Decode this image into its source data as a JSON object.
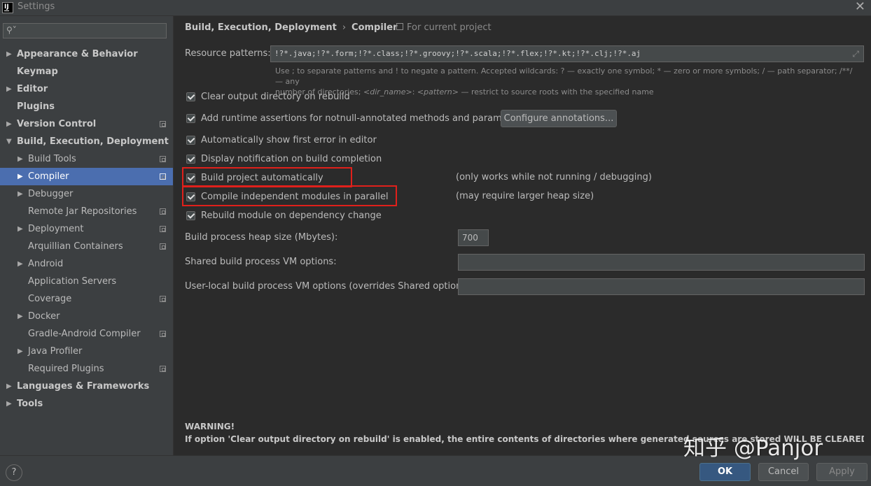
{
  "window": {
    "title": "Settings"
  },
  "sidebar": {
    "search_placeholder": "",
    "items": [
      {
        "label": "Appearance & Behavior",
        "arrow": "▶"
      },
      {
        "label": "Keymap"
      },
      {
        "label": "Editor",
        "arrow": "▶"
      },
      {
        "label": "Plugins"
      },
      {
        "label": "Version Control",
        "arrow": "▶"
      },
      {
        "label": "Build, Execution, Deployment",
        "arrow": "▼"
      },
      {
        "label": "Build Tools",
        "arrow": "▶"
      },
      {
        "label": "Compiler",
        "arrow": "▶"
      },
      {
        "label": "Debugger",
        "arrow": "▶"
      },
      {
        "label": "Remote Jar Repositories"
      },
      {
        "label": "Deployment",
        "arrow": "▶"
      },
      {
        "label": "Arquillian Containers"
      },
      {
        "label": "Android",
        "arrow": "▶"
      },
      {
        "label": "Application Servers"
      },
      {
        "label": "Coverage"
      },
      {
        "label": "Docker",
        "arrow": "▶"
      },
      {
        "label": "Gradle-Android Compiler"
      },
      {
        "label": "Java Profiler",
        "arrow": "▶"
      },
      {
        "label": "Required Plugins"
      },
      {
        "label": "Languages & Frameworks",
        "arrow": "▶"
      },
      {
        "label": "Tools",
        "arrow": "▶"
      }
    ]
  },
  "breadcrumb": {
    "parent": "Build, Execution, Deployment",
    "separator": "›",
    "current": "Compiler"
  },
  "scope_label": "For current project",
  "resource_patterns": {
    "label": "Resource patterns:",
    "value": "!?*.java;!?*.form;!?*.class;!?*.groovy;!?*.scala;!?*.flex;!?*.kt;!?*.clj;!?*.aj",
    "hint_line1": "Use ; to separate patterns and ! to negate a pattern. Accepted wildcards: ? — exactly one symbol; * — zero or more symbols; / — path separator; /**/ — any",
    "hint_line2_prefix": "number of directories;",
    "hint_dir": "<dir_name>",
    "hint_colon": ":",
    "hint_pattern": "<pattern>",
    "hint_line2_suffix": "— restrict to source roots with the specified name"
  },
  "options": {
    "clear_output": "Clear output directory on rebuild",
    "runtime_assertions": "Add runtime assertions for notnull-annotated methods and parameters",
    "configure_annotations": "Configure annotations...",
    "show_first_error": "Automatically show first error in editor",
    "display_notification": "Display notification on build completion",
    "build_automatically": "Build project automatically",
    "build_automatically_note": "(only works while not running / debugging)",
    "parallel": "Compile independent modules in parallel",
    "parallel_note": "(may require larger heap size)",
    "rebuild_on_dependency": "Rebuild module on dependency change"
  },
  "heap": {
    "label": "Build process heap size (Mbytes):",
    "value": "700"
  },
  "shared_vm": {
    "label": "Shared build process VM options:",
    "value": ""
  },
  "user_vm": {
    "label": "User-local build process VM options (overrides Shared options):",
    "value": ""
  },
  "warning": {
    "title": "WARNING!",
    "text": "If option 'Clear output directory on rebuild' is enabled, the entire contents of directories where generated sources are stored WILL BE CLEARED on rebuild."
  },
  "buttons": {
    "help": "?",
    "ok": "OK",
    "cancel": "Cancel",
    "apply": "Apply"
  },
  "watermark": "知乎 @Panjor",
  "colors": {
    "accent": "#4b6eaf",
    "highlight": "#e0201b",
    "ok": "#365880"
  }
}
